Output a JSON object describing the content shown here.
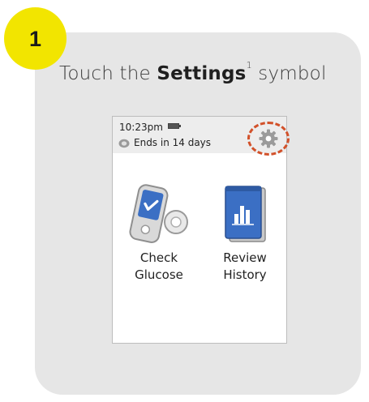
{
  "step": {
    "number": "1"
  },
  "instruction": {
    "prefix": "Touch the ",
    "bold": "Settings",
    "superscript": "1",
    "suffix": " symbol"
  },
  "device_screen": {
    "status_bar": {
      "time": "10:23pm",
      "sensor_status": "Ends in 14 days"
    },
    "tiles": [
      {
        "line1": "Check",
        "line2": "Glucose",
        "icon": "meter-with-sensor-icon"
      },
      {
        "line1": "Review",
        "line2": "History",
        "icon": "logbook-chart-icon"
      }
    ]
  },
  "colors": {
    "badge": "#f2e500",
    "card": "#e6e6e6",
    "highlight_circle": "#d2512a",
    "tile_blue": "#3b6fc4"
  }
}
